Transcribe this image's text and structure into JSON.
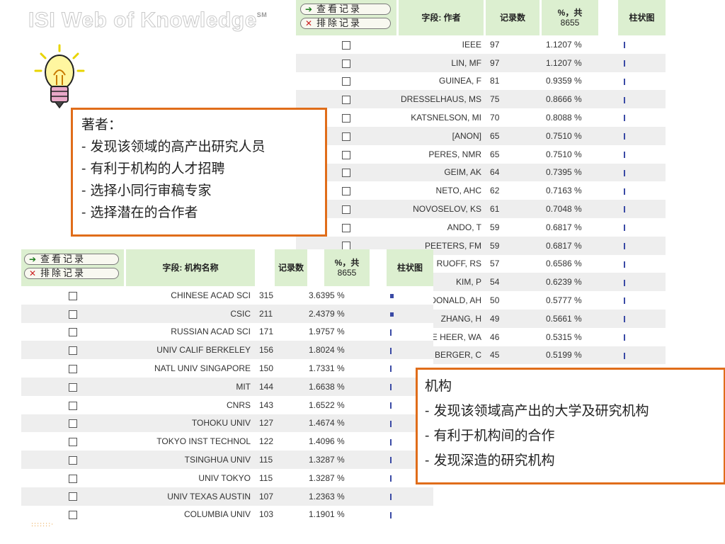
{
  "logo": {
    "text": "ISI Web of Knowledge",
    "mark": "SM"
  },
  "buttons": {
    "view": "查看记录",
    "exclude": "排除记录"
  },
  "author_table": {
    "headers": {
      "field": "字段: 作者",
      "count": "记录数",
      "pct_label": "%，共",
      "pct_total": "8655",
      "chart": "柱状图"
    },
    "rows": [
      {
        "name": "IEEE",
        "count": "97",
        "pct": "1.1207 %"
      },
      {
        "name": "LIN, MF",
        "count": "97",
        "pct": "1.1207 %"
      },
      {
        "name": "GUINEA, F",
        "count": "81",
        "pct": "0.9359 %"
      },
      {
        "name": "DRESSELHAUS, MS",
        "count": "75",
        "pct": "0.8666 %"
      },
      {
        "name": "KATSNELSON, MI",
        "count": "70",
        "pct": "0.8088 %"
      },
      {
        "name": "[ANON]",
        "count": "65",
        "pct": "0.7510 %"
      },
      {
        "name": "PERES, NMR",
        "count": "65",
        "pct": "0.7510 %"
      },
      {
        "name": "GEIM, AK",
        "count": "64",
        "pct": "0.7395 %"
      },
      {
        "name": "NETO, AHC",
        "count": "62",
        "pct": "0.7163 %"
      },
      {
        "name": "NOVOSELOV, KS",
        "count": "61",
        "pct": "0.7048 %"
      },
      {
        "name": "ANDO, T",
        "count": "59",
        "pct": "0.6817 %"
      },
      {
        "name": "PEETERS, FM",
        "count": "59",
        "pct": "0.6817 %"
      },
      {
        "name": "RUOFF, RS",
        "count": "57",
        "pct": "0.6586 %"
      },
      {
        "name": "KIM, P",
        "count": "54",
        "pct": "0.6239 %"
      },
      {
        "name": "DONALD, AH",
        "count": "50",
        "pct": "0.5777 %"
      },
      {
        "name": "ZHANG, H",
        "count": "49",
        "pct": "0.5661 %"
      },
      {
        "name": "E HEER, WA",
        "count": "46",
        "pct": "0.5315 %"
      },
      {
        "name": "BERGER, C",
        "count": "45",
        "pct": "0.5199 %"
      }
    ]
  },
  "org_table": {
    "headers": {
      "field": "字段: 机构名称",
      "count": "记录数",
      "pct_label": "%，共",
      "pct_total": "8655",
      "chart": "柱状图"
    },
    "rows": [
      {
        "name": "CHINESE ACAD SCI",
        "count": "315",
        "pct": "3.6395 %"
      },
      {
        "name": "CSIC",
        "count": "211",
        "pct": "2.4379 %"
      },
      {
        "name": "RUSSIAN ACAD SCI",
        "count": "171",
        "pct": "1.9757 %"
      },
      {
        "name": "UNIV CALIF BERKELEY",
        "count": "156",
        "pct": "1.8024 %"
      },
      {
        "name": "NATL UNIV SINGAPORE",
        "count": "150",
        "pct": "1.7331 %"
      },
      {
        "name": "MIT",
        "count": "144",
        "pct": "1.6638 %"
      },
      {
        "name": "CNRS",
        "count": "143",
        "pct": "1.6522 %"
      },
      {
        "name": "TOHOKU UNIV",
        "count": "127",
        "pct": "1.4674 %"
      },
      {
        "name": "TOKYO INST TECHNOL",
        "count": "122",
        "pct": "1.4096 %"
      },
      {
        "name": "TSINGHUA UNIV",
        "count": "115",
        "pct": "1.3287 %"
      },
      {
        "name": "UNIV TOKYO",
        "count": "115",
        "pct": "1.3287 %"
      },
      {
        "name": "UNIV TEXAS AUSTIN",
        "count": "107",
        "pct": "1.2363 %"
      },
      {
        "name": "COLUMBIA UNIV",
        "count": "103",
        "pct": "1.1901 %"
      }
    ]
  },
  "callout_authors": {
    "title": "著者：",
    "lines": [
      "- 发现该领域的高产出研究人员",
      "- 有利于机构的人才招聘",
      "- 选择小同行审稿专家",
      "- 选择潜在的合作者"
    ]
  },
  "callout_orgs": {
    "title": "机构",
    "lines": [
      "- 发现该领域高产出的大学及研究机构",
      "- 有利于机构间的合作",
      "- 发现深造的研究机构"
    ]
  },
  "colors": {
    "accent": "#e06d1a",
    "header_bg": "#dcefd0",
    "bar": "#3a4aa5"
  }
}
